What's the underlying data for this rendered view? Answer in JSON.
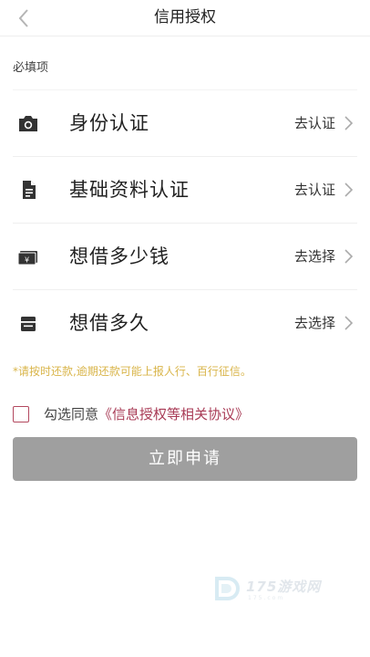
{
  "header": {
    "title": "信用授权",
    "back_icon": "chevron-left-icon"
  },
  "section_label": "必填项",
  "items": [
    {
      "icon": "camera-icon",
      "label": "身份认证",
      "action": "去认证"
    },
    {
      "icon": "document-icon",
      "label": "基础资料认证",
      "action": "去认证"
    },
    {
      "icon": "money-icon",
      "label": "想借多少钱",
      "action": "去选择"
    },
    {
      "icon": "card-icon",
      "label": "想借多久",
      "action": "去选择"
    }
  ],
  "notice": "*请按时还款,逾期还款可能上报人行、百行征信。",
  "agreement": {
    "prefix": "勾选同意",
    "link": "《信息授权等相关协议》",
    "checked": false
  },
  "submit_label": "立即申请",
  "watermark": {
    "text": "175游戏网",
    "sub": "175.com"
  },
  "colors": {
    "accent": "#a83a55",
    "notice": "#d9b54a",
    "button": "#9f9f9f"
  }
}
